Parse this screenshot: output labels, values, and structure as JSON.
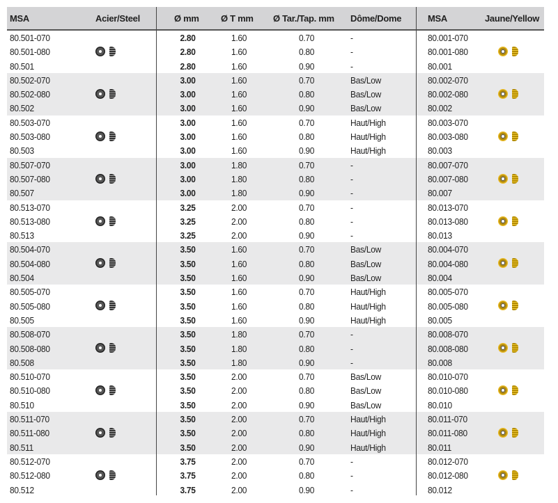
{
  "headers": {
    "msa": "MSA",
    "steel": "Acier/Steel",
    "diameter": "Ø mm",
    "t_diameter": "Ø T mm",
    "tap": "Ø Tar./Tap. mm",
    "dome": "Dôme/Dome",
    "msa_yellow": "MSA",
    "yellow": "Jaune/Yellow"
  },
  "icons": {
    "steel": "steel-crown-icon",
    "yellow": "gold-crown-icon"
  },
  "colors": {
    "header_bg": "#d4d4d6",
    "shade_bg": "#e9e9ea",
    "steel": "#444444",
    "gold": "#e8b820"
  },
  "groups": [
    {
      "rows": [
        {
          "msa": "80.501-070",
          "dia": "2.80",
          "t": "1.60",
          "tap": "0.70",
          "dome": "-",
          "msa2": "80.001-070"
        },
        {
          "msa": "80.501-080",
          "dia": "2.80",
          "t": "1.60",
          "tap": "0.80",
          "dome": "-",
          "msa2": "80.001-080"
        },
        {
          "msa": "80.501",
          "dia": "2.80",
          "t": "1.60",
          "tap": "0.90",
          "dome": "-",
          "msa2": "80.001"
        }
      ]
    },
    {
      "rows": [
        {
          "msa": "80.502-070",
          "dia": "3.00",
          "t": "1.60",
          "tap": "0.70",
          "dome": "Bas/Low",
          "msa2": "80.002-070"
        },
        {
          "msa": "80.502-080",
          "dia": "3.00",
          "t": "1.60",
          "tap": "0.80",
          "dome": "Bas/Low",
          "msa2": "80.002-080"
        },
        {
          "msa": "80.502",
          "dia": "3.00",
          "t": "1.60",
          "tap": "0.90",
          "dome": "Bas/Low",
          "msa2": "80.002"
        }
      ]
    },
    {
      "rows": [
        {
          "msa": "80.503-070",
          "dia": "3.00",
          "t": "1.60",
          "tap": "0.70",
          "dome": "Haut/High",
          "msa2": "80.003-070"
        },
        {
          "msa": "80.503-080",
          "dia": "3.00",
          "t": "1.60",
          "tap": "0.80",
          "dome": "Haut/High",
          "msa2": "80.003-080"
        },
        {
          "msa": "80.503",
          "dia": "3.00",
          "t": "1.60",
          "tap": "0.90",
          "dome": "Haut/High",
          "msa2": "80.003"
        }
      ]
    },
    {
      "rows": [
        {
          "msa": "80.507-070",
          "dia": "3.00",
          "t": "1.80",
          "tap": "0.70",
          "dome": "-",
          "msa2": "80.007-070"
        },
        {
          "msa": "80.507-080",
          "dia": "3.00",
          "t": "1.80",
          "tap": "0.80",
          "dome": "-",
          "msa2": "80.007-080"
        },
        {
          "msa": "80.507",
          "dia": "3.00",
          "t": "1.80",
          "tap": "0.90",
          "dome": "-",
          "msa2": "80.007"
        }
      ]
    },
    {
      "rows": [
        {
          "msa": "80.513-070",
          "dia": "3.25",
          "t": "2.00",
          "tap": "0.70",
          "dome": "-",
          "msa2": "80.013-070"
        },
        {
          "msa": "80.513-080",
          "dia": "3.25",
          "t": "2.00",
          "tap": "0.80",
          "dome": "-",
          "msa2": "80.013-080"
        },
        {
          "msa": "80.513",
          "dia": "3.25",
          "t": "2.00",
          "tap": "0.90",
          "dome": "-",
          "msa2": "80.013"
        }
      ]
    },
    {
      "rows": [
        {
          "msa": "80.504-070",
          "dia": "3.50",
          "t": "1.60",
          "tap": "0.70",
          "dome": "Bas/Low",
          "msa2": "80.004-070"
        },
        {
          "msa": "80.504-080",
          "dia": "3.50",
          "t": "1.60",
          "tap": "0.80",
          "dome": "Bas/Low",
          "msa2": "80.004-080"
        },
        {
          "msa": "80.504",
          "dia": "3.50",
          "t": "1.60",
          "tap": "0.90",
          "dome": "Bas/Low",
          "msa2": "80.004"
        }
      ]
    },
    {
      "rows": [
        {
          "msa": "80.505-070",
          "dia": "3.50",
          "t": "1.60",
          "tap": "0.70",
          "dome": "Haut/High",
          "msa2": "80.005-070"
        },
        {
          "msa": "80.505-080",
          "dia": "3.50",
          "t": "1.60",
          "tap": "0.80",
          "dome": "Haut/High",
          "msa2": "80.005-080"
        },
        {
          "msa": "80.505",
          "dia": "3.50",
          "t": "1.60",
          "tap": "0.90",
          "dome": "Haut/High",
          "msa2": "80.005"
        }
      ]
    },
    {
      "rows": [
        {
          "msa": "80.508-070",
          "dia": "3.50",
          "t": "1.80",
          "tap": "0.70",
          "dome": "-",
          "msa2": "80.008-070"
        },
        {
          "msa": "80.508-080",
          "dia": "3.50",
          "t": "1.80",
          "tap": "0.80",
          "dome": "-",
          "msa2": "80.008-080"
        },
        {
          "msa": "80.508",
          "dia": "3.50",
          "t": "1.80",
          "tap": "0.90",
          "dome": "-",
          "msa2": "80.008"
        }
      ]
    },
    {
      "rows": [
        {
          "msa": "80.510-070",
          "dia": "3.50",
          "t": "2.00",
          "tap": "0.70",
          "dome": "Bas/Low",
          "msa2": "80.010-070"
        },
        {
          "msa": "80.510-080",
          "dia": "3.50",
          "t": "2.00",
          "tap": "0.80",
          "dome": "Bas/Low",
          "msa2": "80.010-080"
        },
        {
          "msa": "80.510",
          "dia": "3.50",
          "t": "2.00",
          "tap": "0.90",
          "dome": "Bas/Low",
          "msa2": "80.010"
        }
      ]
    },
    {
      "rows": [
        {
          "msa": "80.511-070",
          "dia": "3.50",
          "t": "2.00",
          "tap": "0.70",
          "dome": "Haut/High",
          "msa2": "80.011-070"
        },
        {
          "msa": "80.511-080",
          "dia": "3.50",
          "t": "2.00",
          "tap": "0.80",
          "dome": "Haut/High",
          "msa2": "80.011-080"
        },
        {
          "msa": "80.511",
          "dia": "3.50",
          "t": "2.00",
          "tap": "0.90",
          "dome": "Haut/High",
          "msa2": "80.011"
        }
      ]
    },
    {
      "rows": [
        {
          "msa": "80.512-070",
          "dia": "3.75",
          "t": "2.00",
          "tap": "0.70",
          "dome": "-",
          "msa2": "80.012-070"
        },
        {
          "msa": "80.512-080",
          "dia": "3.75",
          "t": "2.00",
          "tap": "0.80",
          "dome": "-",
          "msa2": "80.012-080"
        },
        {
          "msa": "80.512",
          "dia": "3.75",
          "t": "2.00",
          "tap": "0.90",
          "dome": "-",
          "msa2": "80.012"
        }
      ]
    }
  ]
}
